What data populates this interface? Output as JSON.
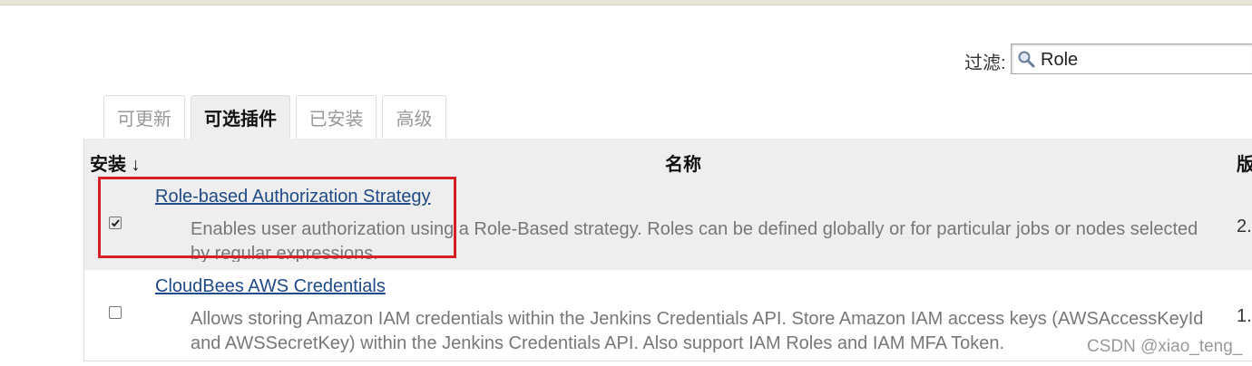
{
  "filter": {
    "label": "过滤:",
    "value": "Role",
    "icon": "magnifier-icon"
  },
  "tabs": [
    {
      "label": "可更新",
      "active": false
    },
    {
      "label": "可选插件",
      "active": true
    },
    {
      "label": "已安装",
      "active": false
    },
    {
      "label": "高级",
      "active": false
    }
  ],
  "table": {
    "headers": {
      "install": "安装 ↓",
      "name": "名称",
      "version": "版"
    },
    "rows": [
      {
        "name": "Role-based Authorization Strategy",
        "description": "Enables user authorization using a Role-Based strategy. Roles can be defined globally or for particular jobs or nodes selected by regular expressions.",
        "version": "2.",
        "checked": true
      },
      {
        "name": "CloudBees AWS Credentials",
        "description": "Allows storing Amazon IAM credentials within the Jenkins Credentials API. Store Amazon IAM access keys (AWSAccessKeyId and AWSSecretKey) within the Jenkins Credentials API. Also support IAM Roles and IAM MFA Token.",
        "version": "1.",
        "checked": false
      }
    ]
  },
  "watermark": "CSDN @xiao_teng_",
  "colors": {
    "highlight": "#d81e27",
    "link": "#204a87",
    "header_bg": "#eeeeee"
  }
}
